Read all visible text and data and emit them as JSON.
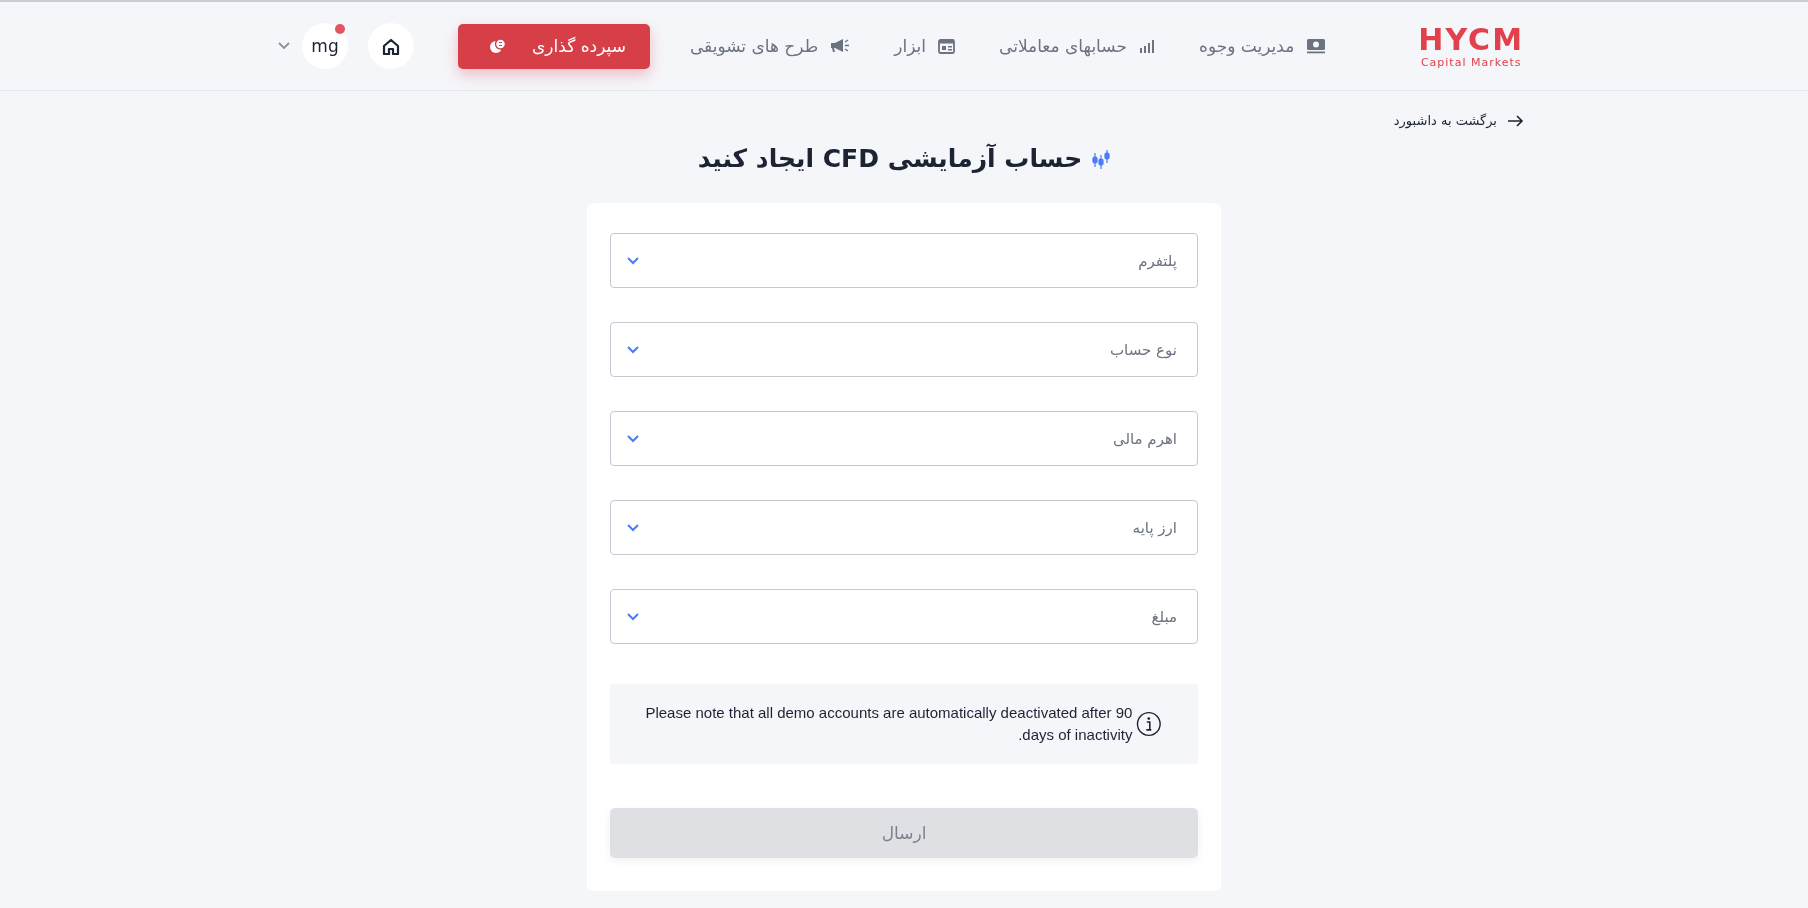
{
  "header": {
    "logo": {
      "name": "HYCM",
      "tagline": "Capital Markets"
    },
    "nav": [
      {
        "label": "مدیریت وجوه",
        "kind": "money"
      },
      {
        "label": "حسابهای معاملاتی",
        "kind": "chart"
      },
      {
        "label": "ابزار",
        "kind": "table"
      },
      {
        "label": "طرح های تشویقی",
        "kind": "megaphone"
      }
    ],
    "deposit_button": "سپرده گذاری",
    "avatar": "mg"
  },
  "back_link": "برگشت به داشبورد",
  "title": "حساب آزمایشی CFD ایجاد کنید",
  "fields": [
    {
      "placeholder": "پلتفرم"
    },
    {
      "placeholder": "نوع حساب"
    },
    {
      "placeholder": "اهرم مالی"
    },
    {
      "placeholder": "ارز پایه"
    },
    {
      "placeholder": "مبلغ"
    }
  ],
  "note": "Please note that all demo accounts are automatically deactivated after 90 days of inactivity.",
  "submit": {
    "label": "ارسال",
    "disabled": true
  }
}
